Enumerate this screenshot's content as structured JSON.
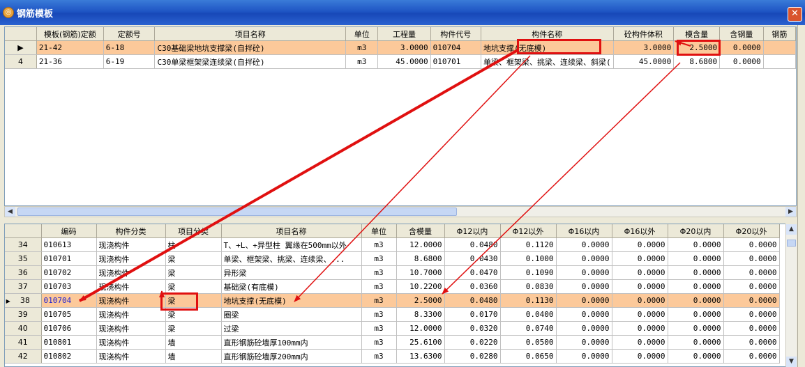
{
  "window": {
    "title": "钢筋模板",
    "close_glyph": "✕",
    "icon": "app-logo-icon",
    "icon_glyph": "◎"
  },
  "top_table": {
    "headers": [
      "",
      "模板(钢筋)定额",
      "定额号",
      "项目名称",
      "单位",
      "工程量",
      "构件代号",
      "构件名称",
      "砼构件体积",
      "模含量",
      "含钢量",
      "钢筋"
    ],
    "rows": [
      {
        "marker": "▶",
        "template_no": "21-42",
        "quota_no": "6-18",
        "name": "C30基础梁地坑支撑梁(自拌砼)",
        "unit": "m3",
        "quantity": "3.0000",
        "code": "010704",
        "component": "地坑支撑(无底模)",
        "volume": "3.0000",
        "mold_content": "2.5000",
        "steel_content": "0.0000",
        "selected": true
      },
      {
        "marker": "4",
        "template_no": "21-36",
        "quota_no": "6-19",
        "name": "C30单梁框架梁连续梁(自拌砼)",
        "unit": "m3",
        "quantity": "45.0000",
        "code": "010701",
        "component": "单梁、框架梁、挑梁、连续梁、斜梁(",
        "volume": "45.0000",
        "mold_content": "8.6800",
        "steel_content": "0.0000",
        "selected": false
      }
    ]
  },
  "bottom_table": {
    "headers": [
      "",
      "编码",
      "构件分类",
      "项目分类",
      "项目名称",
      "单位",
      "含模量",
      "Φ12以内",
      "Φ12以外",
      "Φ16以内",
      "Φ16以外",
      "Φ20以内",
      "Φ20以外"
    ],
    "rows": [
      {
        "idx": "34",
        "code": "010613",
        "cat": "现浇构件",
        "sub": "柱",
        "name": "T、+L、+异型柱 翼缘在500mm以外",
        "unit": "m3",
        "mold": "12.0000",
        "p12in": "0.0480",
        "p12out": "0.1120",
        "p16in": "0.0000",
        "p16out": "0.0000",
        "p20in": "0.0000",
        "p20out": "0.0000",
        "selected": false
      },
      {
        "idx": "35",
        "code": "010701",
        "cat": "现浇构件",
        "sub": "梁",
        "name": "单梁、框架梁、挑梁、连续梁、...",
        "unit": "m3",
        "mold": "8.6800",
        "p12in": "0.0430",
        "p12out": "0.1000",
        "p16in": "0.0000",
        "p16out": "0.0000",
        "p20in": "0.0000",
        "p20out": "0.0000",
        "selected": false
      },
      {
        "idx": "36",
        "code": "010702",
        "cat": "现浇构件",
        "sub": "梁",
        "name": "异形梁",
        "unit": "m3",
        "mold": "10.7000",
        "p12in": "0.0470",
        "p12out": "0.1090",
        "p16in": "0.0000",
        "p16out": "0.0000",
        "p20in": "0.0000",
        "p20out": "0.0000",
        "selected": false
      },
      {
        "idx": "37",
        "code": "010703",
        "cat": "现浇构件",
        "sub": "梁",
        "name": "基础梁(有底模)",
        "unit": "m3",
        "mold": "10.2200",
        "p12in": "0.0360",
        "p12out": "0.0830",
        "p16in": "0.0000",
        "p16out": "0.0000",
        "p20in": "0.0000",
        "p20out": "0.0000",
        "selected": false
      },
      {
        "idx": "38",
        "code": "010704",
        "cat": "现浇构件",
        "sub": "梁",
        "name": "地坑支撑(无底模)",
        "unit": "m3",
        "mold": "2.5000",
        "p12in": "0.0480",
        "p12out": "0.1130",
        "p16in": "0.0000",
        "p16out": "0.0000",
        "p20in": "0.0000",
        "p20out": "0.0000",
        "selected": true
      },
      {
        "idx": "39",
        "code": "010705",
        "cat": "现浇构件",
        "sub": "梁",
        "name": "圈梁",
        "unit": "m3",
        "mold": "8.3300",
        "p12in": "0.0170",
        "p12out": "0.0400",
        "p16in": "0.0000",
        "p16out": "0.0000",
        "p20in": "0.0000",
        "p20out": "0.0000",
        "selected": false
      },
      {
        "idx": "40",
        "code": "010706",
        "cat": "现浇构件",
        "sub": "梁",
        "name": "过梁",
        "unit": "m3",
        "mold": "12.0000",
        "p12in": "0.0320",
        "p12out": "0.0740",
        "p16in": "0.0000",
        "p16out": "0.0000",
        "p20in": "0.0000",
        "p20out": "0.0000",
        "selected": false
      },
      {
        "idx": "41",
        "code": "010801",
        "cat": "现浇构件",
        "sub": "墙",
        "name": "直形钢筋砼墙厚100mm内",
        "unit": "m3",
        "mold": "25.6100",
        "p12in": "0.0220",
        "p12out": "0.0500",
        "p16in": "0.0000",
        "p16out": "0.0000",
        "p20in": "0.0000",
        "p20out": "0.0000",
        "selected": false
      },
      {
        "idx": "42",
        "code": "010802",
        "cat": "现浇构件",
        "sub": "墙",
        "name": "直形钢筋砼墙厚200mm内",
        "unit": "m3",
        "mold": "13.6300",
        "p12in": "0.0280",
        "p12out": "0.0650",
        "p16in": "0.0000",
        "p16out": "0.0000",
        "p20in": "0.0000",
        "p20out": "0.0000",
        "selected": false
      }
    ]
  },
  "colors": {
    "selected_row": "#fcc99a",
    "annotation": "#e01010",
    "titlebar": "#1f55c4"
  },
  "scroll_glyphs": {
    "left": "◀",
    "right": "▶",
    "up": "▲",
    "down": "▼"
  }
}
